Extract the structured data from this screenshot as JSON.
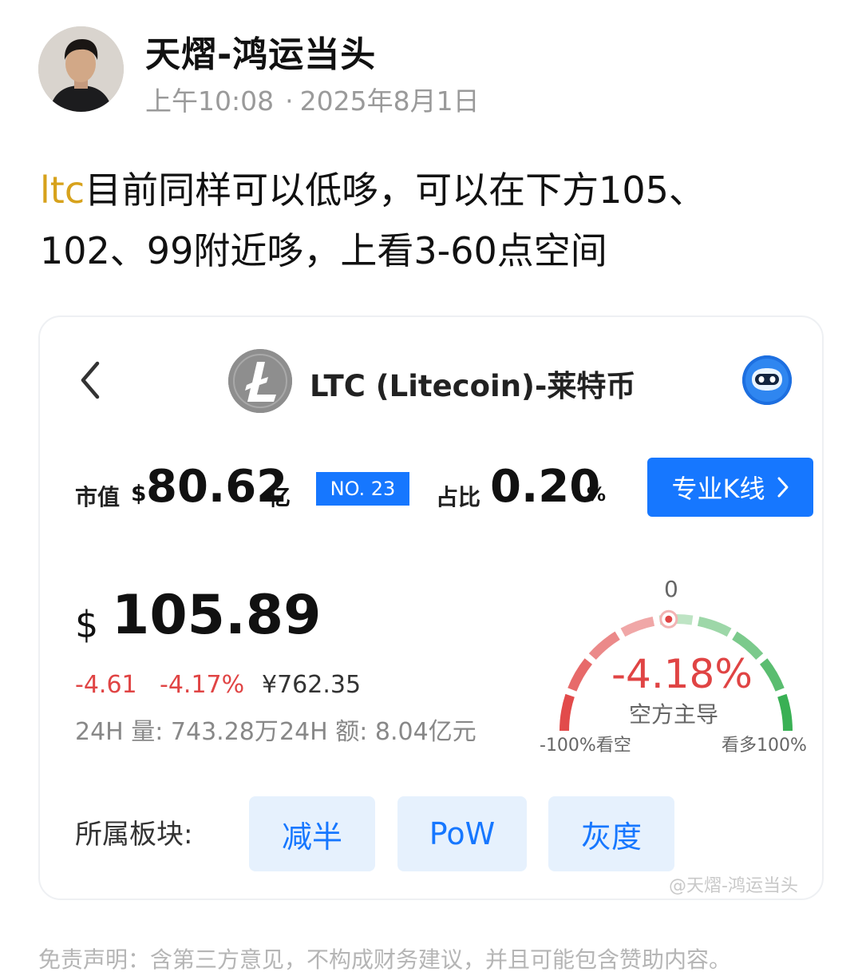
{
  "post": {
    "author": "天熠-鸿运当头",
    "time": "上午10:08",
    "date": "2025年8月1日",
    "separator": "·",
    "tag": "ltc",
    "text_line1": "目前同样可以低哆，可以在下方105、",
    "text_line2": "102、99附近哆，上看3-60点空间"
  },
  "card": {
    "coin_title": "LTC (Litecoin)-莱特币",
    "market_cap": {
      "label": "市值",
      "currency": "$",
      "value": "80.62",
      "unit": "亿"
    },
    "rank": "NO. 23",
    "share": {
      "label": "占比",
      "value": "0.20",
      "unit": "%"
    },
    "kline_button": "专业K线",
    "price": {
      "symbol": "$",
      "value": "105.89",
      "change": "-4.61",
      "change_pct": "-4.17%",
      "cny": "¥762.35",
      "volume": "24H 量: 743.28万",
      "amount": "24H 额: 8.04亿元"
    },
    "gauge": {
      "zero_label": "0",
      "pct": "-4.18%",
      "label": "空方主导",
      "left_label": "-100%看空",
      "right_label": "看多100%",
      "value_pct": -4.18
    },
    "sectors": {
      "label": "所属板块:",
      "items": [
        "减半",
        "PoW",
        "灰度"
      ]
    },
    "watermark": "@天熠-鸿运当头"
  },
  "disclaimer": "免责声明：含第三方意见，不构成财务建议，并且可能包含赞助内容。",
  "colors": {
    "accent_blue": "#1677ff",
    "negative_red": "#e04444",
    "tag_gold": "#d7a21c",
    "positive_green": "#2eb84a"
  }
}
